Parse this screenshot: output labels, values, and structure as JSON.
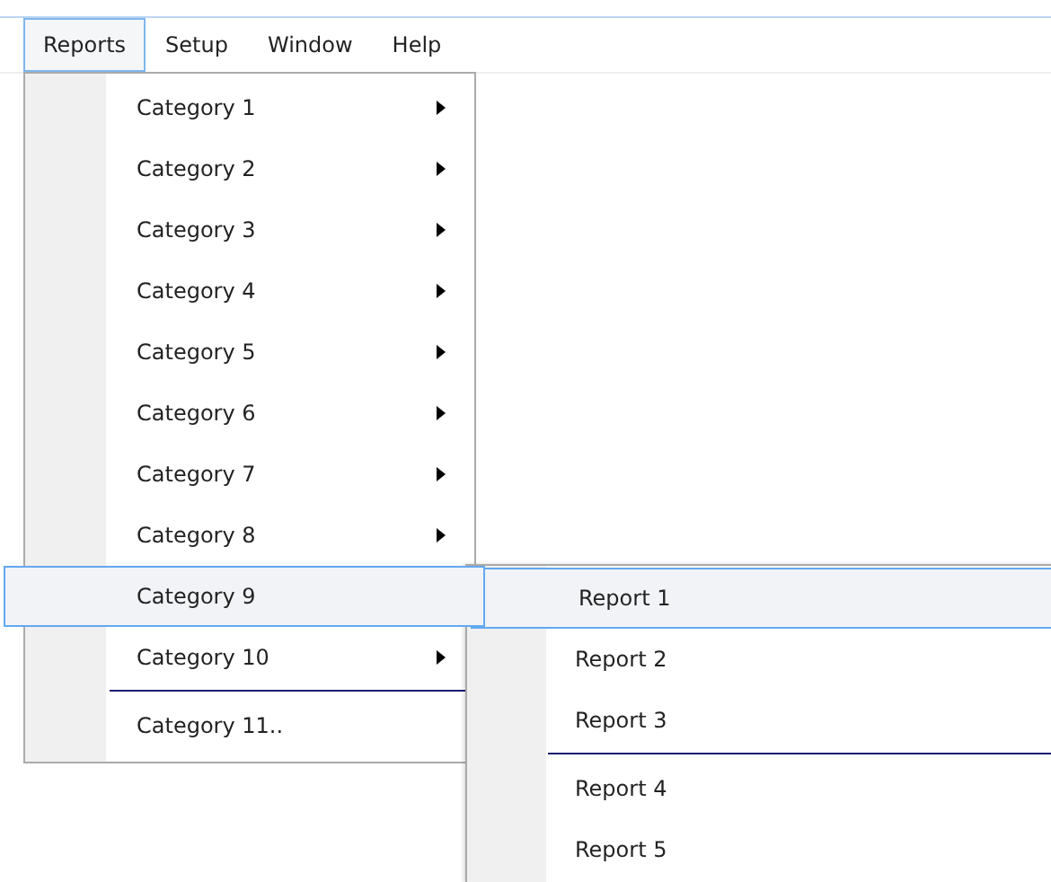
{
  "menubar": [
    {
      "label": "Reports",
      "selected": true
    },
    {
      "label": "Setup",
      "selected": false
    },
    {
      "label": "Window",
      "selected": false
    },
    {
      "label": "Help",
      "selected": false
    }
  ],
  "menu": [
    {
      "kind": "item",
      "label": "Category 1",
      "has_submenu": true,
      "selected": false
    },
    {
      "kind": "item",
      "label": "Category 2",
      "has_submenu": true,
      "selected": false
    },
    {
      "kind": "item",
      "label": "Category 3",
      "has_submenu": true,
      "selected": false
    },
    {
      "kind": "item",
      "label": "Category 4",
      "has_submenu": true,
      "selected": false
    },
    {
      "kind": "item",
      "label": "Category 5",
      "has_submenu": true,
      "selected": false
    },
    {
      "kind": "item",
      "label": "Category 6",
      "has_submenu": true,
      "selected": false
    },
    {
      "kind": "item",
      "label": "Category 7",
      "has_submenu": true,
      "selected": false
    },
    {
      "kind": "item",
      "label": "Category 8",
      "has_submenu": true,
      "selected": false
    },
    {
      "kind": "item",
      "label": "Category 9",
      "has_submenu": false,
      "selected": true
    },
    {
      "kind": "item",
      "label": "Category 10",
      "has_submenu": true,
      "selected": false
    },
    {
      "kind": "separator"
    },
    {
      "kind": "item",
      "label": "Category 11..",
      "has_submenu": false,
      "selected": false
    }
  ],
  "submenu": [
    {
      "kind": "item",
      "label": "Report 1",
      "selected": true
    },
    {
      "kind": "item",
      "label": "Report 2",
      "selected": false
    },
    {
      "kind": "item",
      "label": "Report 3",
      "selected": false
    },
    {
      "kind": "separator"
    },
    {
      "kind": "item",
      "label": "Report 4",
      "selected": false
    },
    {
      "kind": "item",
      "label": "Report 5",
      "selected": false
    }
  ]
}
